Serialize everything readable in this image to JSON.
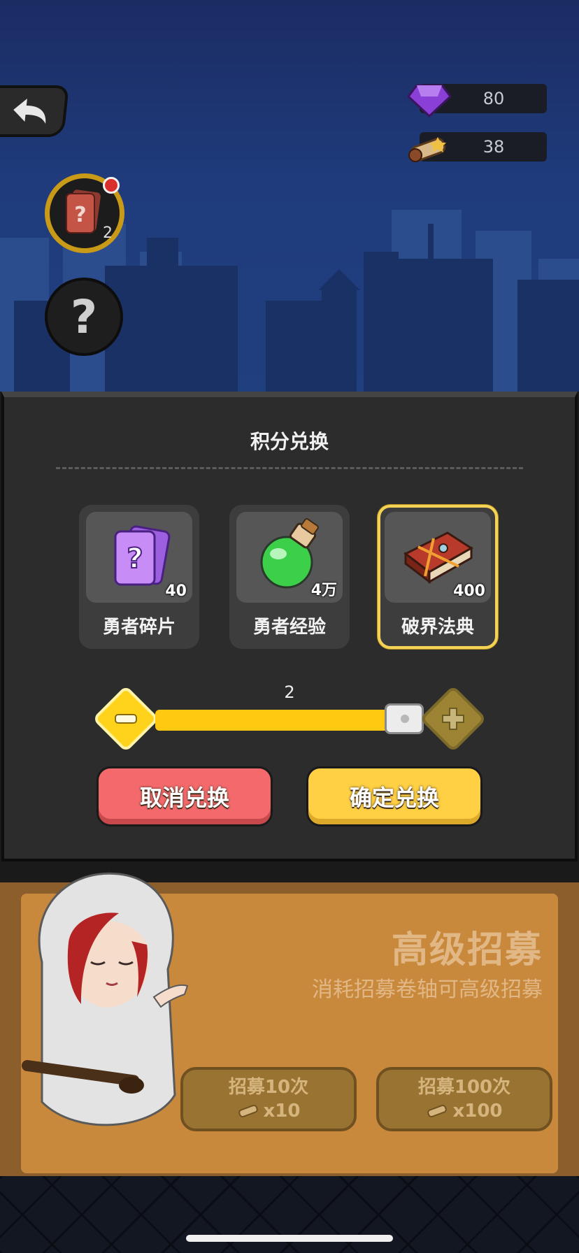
{
  "resources": {
    "gems": "80",
    "scrolls": "38"
  },
  "left_buttons": {
    "card_count": "2"
  },
  "dialog": {
    "title": "积分兑换",
    "items": [
      {
        "name": "勇者碎片",
        "qty": "40",
        "icon": "purple-card-icon",
        "selected": false
      },
      {
        "name": "勇者经验",
        "qty": "4万",
        "icon": "green-potion-icon",
        "selected": false
      },
      {
        "name": "破界法典",
        "qty": "400",
        "icon": "red-book-icon",
        "selected": true
      }
    ],
    "quantity": "2",
    "slider_fraction": 1.0,
    "cancel_label": "取消兑换",
    "confirm_label": "确定兑换"
  },
  "banner": {
    "title": "高级招募",
    "subtitle": "消耗招募卷轴可高级招募",
    "recruit10": {
      "label": "招募10次",
      "cost": "x10"
    },
    "recruit100": {
      "label": "招募100次",
      "cost": "x100"
    }
  },
  "colors": {
    "accent_yellow": "#ffd044",
    "cancel_red": "#f46a6c",
    "selected_border": "#f3d256",
    "banner_orange": "#c9893d"
  }
}
